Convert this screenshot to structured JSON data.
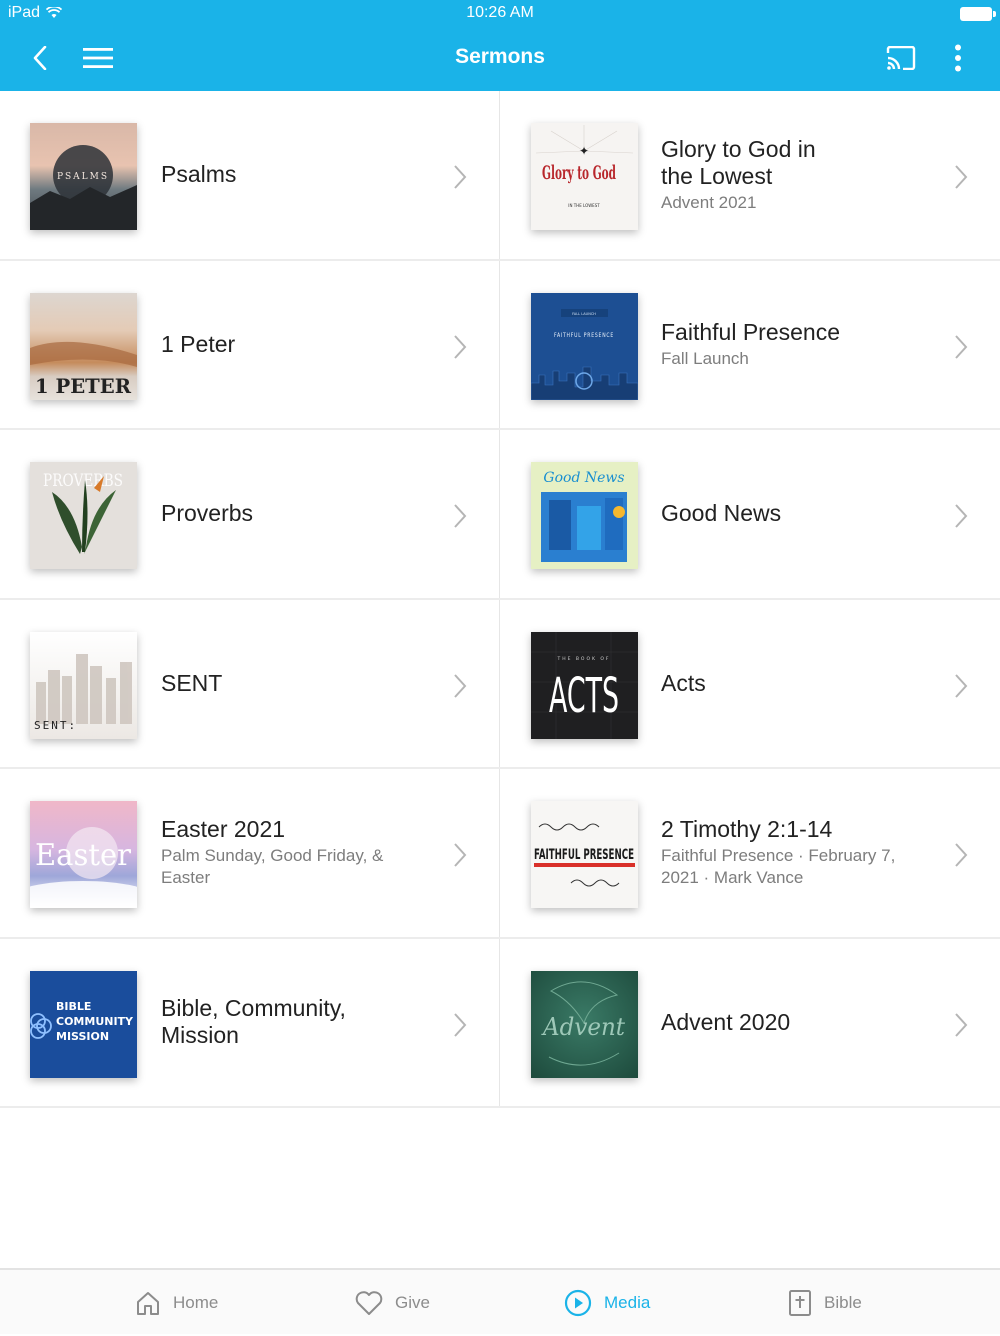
{
  "status_bar": {
    "carrier": "iPad",
    "time": "10:26 AM"
  },
  "nav": {
    "title": "Sermons"
  },
  "colors": {
    "accent": "#1ab3e8"
  },
  "sermons": [
    {
      "title": "Psalms",
      "subtitle": "",
      "art_text": "PSALMS"
    },
    {
      "title": "Glory to God in the Lowest",
      "subtitle": "Advent 2021",
      "art_text": "Glory to God",
      "art_caption": "IN THE LOWEST"
    },
    {
      "title": "1 Peter",
      "subtitle": "",
      "art_text": "1 PETER"
    },
    {
      "title": "Faithful Presence",
      "subtitle": "Fall Launch",
      "art_text": "FAITHFUL PRESENCE",
      "art_caption": "FALL LAUNCH"
    },
    {
      "title": "Proverbs",
      "subtitle": "",
      "art_text": "PROVERBS"
    },
    {
      "title": "Good News",
      "subtitle": "",
      "art_text": "Good News"
    },
    {
      "title": "SENT",
      "subtitle": "",
      "art_text": "SENT:"
    },
    {
      "title": "Acts",
      "subtitle": "",
      "art_text": "ACTS",
      "art_caption": "THE BOOK OF"
    },
    {
      "title": "Easter 2021",
      "subtitle": "Palm Sunday, Good Friday, & Easter",
      "art_text": "Easter"
    },
    {
      "title": "2 Timothy 2:1-14",
      "subtitle": "Faithful Presence · February 7, 2021 · Mark Vance",
      "art_text": "FAITHFUL PRESENCE"
    },
    {
      "title": "Bible, Community, Mission",
      "subtitle": "",
      "art_text": "BIBLE COMMUNITY MISSION"
    },
    {
      "title": "Advent 2020",
      "subtitle": "",
      "art_text": "Advent"
    }
  ],
  "tabs": [
    {
      "label": "Home",
      "icon": "home-icon"
    },
    {
      "label": "Give",
      "icon": "heart-icon"
    },
    {
      "label": "Media",
      "icon": "play-circle-icon",
      "active": true
    },
    {
      "label": "Bible",
      "icon": "bible-icon"
    }
  ]
}
